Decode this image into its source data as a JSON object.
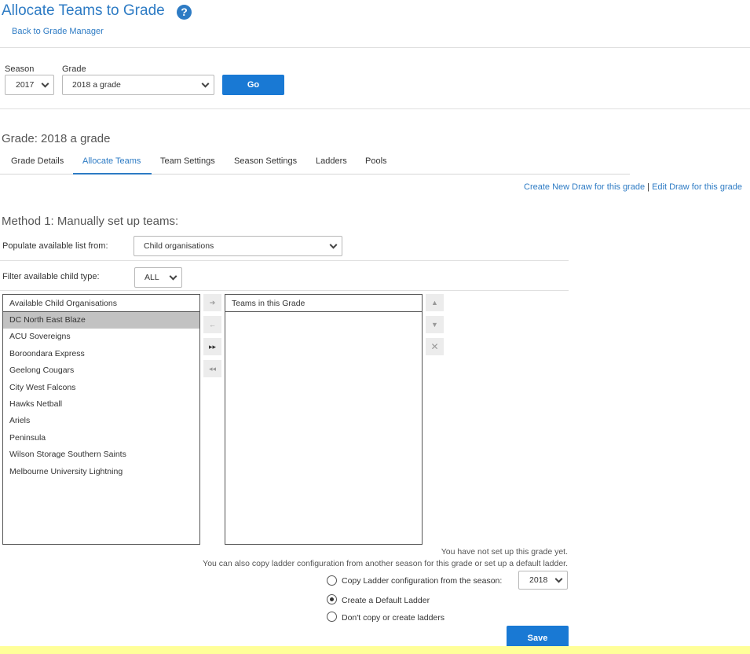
{
  "header": {
    "title": "Allocate Teams to Grade",
    "help_icon": "?",
    "back_link": "Back to Grade Manager"
  },
  "filters": {
    "season_label": "Season",
    "season_value": "2017",
    "grade_label": "Grade",
    "grade_value": "2018 a grade",
    "go_label": "Go"
  },
  "grade": {
    "heading": "Grade: 2018 a grade",
    "tabs": [
      {
        "label": "Grade Details"
      },
      {
        "label": "Allocate Teams"
      },
      {
        "label": "Team Settings"
      },
      {
        "label": "Season Settings"
      },
      {
        "label": "Ladders"
      },
      {
        "label": "Pools"
      }
    ],
    "active_tab": "Allocate Teams",
    "create_draw_link": "Create New Draw for this grade",
    "link_separator": "|",
    "edit_draw_link": "Edit Draw for this grade"
  },
  "method": {
    "heading": "Method 1: Manually set up teams:",
    "populate_label": "Populate available list from:",
    "populate_value": "Child organisations",
    "filter_label": "Filter available child type:",
    "filter_value": "ALL"
  },
  "available": {
    "header": "Available Child Organisations",
    "items": [
      "DC North East Blaze",
      "ACU Sovereigns",
      "Boroondara Express",
      "Geelong Cougars",
      "City West Falcons",
      "Hawks Netball",
      "Ariels",
      "Peninsula",
      "Wilson Storage Southern Saints",
      "Melbourne University Lightning"
    ],
    "selected": "DC North East Blaze"
  },
  "transfer_buttons": {
    "add": "➔",
    "remove": "←",
    "add_all": "▸▸",
    "remove_all": "◂◂"
  },
  "grade_teams": {
    "header": "Teams in this Grade",
    "items": [],
    "move_up": "▲",
    "move_down": "▼",
    "delete": "✕"
  },
  "ladder": {
    "note1": "You have not set up this grade yet.",
    "note2": "You can also copy ladder configuration from another season for this grade or set up a default ladder.",
    "option_copy": "Copy Ladder configuration from the season:",
    "copy_season_value": "2018",
    "option_default": "Create a Default Ladder",
    "option_none": "Don't copy or create ladders",
    "selected_option": "default"
  },
  "save_label": "Save",
  "colors": {
    "accent": "#2d7bc4",
    "button": "#1979d4",
    "selected_row": "#c2c2c2",
    "footer_bar": "#ffff99"
  }
}
